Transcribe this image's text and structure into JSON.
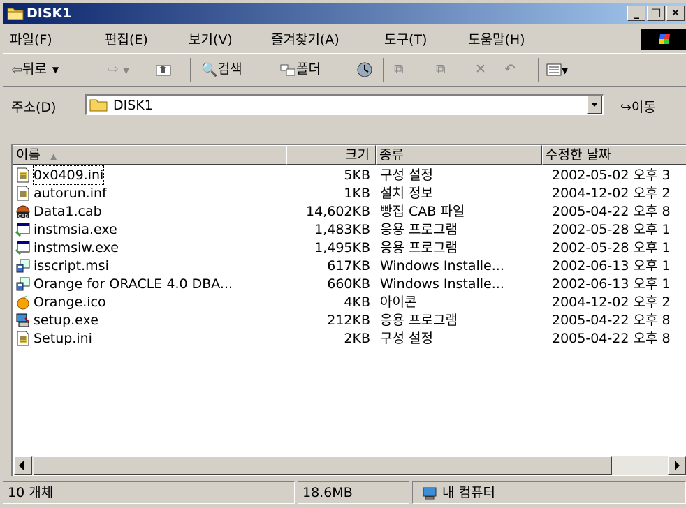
{
  "window": {
    "title": "DISK1"
  },
  "menu": [
    "파일(F)",
    "편집(E)",
    "보기(V)",
    "즐겨찾기(A)",
    "도구(T)",
    "도움말(H)"
  ],
  "toolbar": {
    "back": "뒤로",
    "search": "검색",
    "folders": "폴더"
  },
  "address": {
    "label": "주소(D)",
    "value": "DISK1",
    "go": "이동"
  },
  "columns": {
    "name": "이름",
    "size": "크기",
    "type": "종류",
    "modified": "수정한 날짜"
  },
  "files": [
    {
      "icon": "ini-file-icon",
      "name": "0x0409.ini",
      "size": "5KB",
      "type": "구성 설정",
      "modified": "2002-05-02 오후 3"
    },
    {
      "icon": "ini-file-icon",
      "name": "autorun.inf",
      "size": "1KB",
      "type": "설치 정보",
      "modified": "2004-12-02 오후 2"
    },
    {
      "icon": "cab-file-icon",
      "name": "Data1.cab",
      "size": "14,602KB",
      "type": "빵집 CAB 파일",
      "modified": "2005-04-22 오후 8"
    },
    {
      "icon": "exe-window-icon",
      "name": "instmsia.exe",
      "size": "1,483KB",
      "type": "응용 프로그램",
      "modified": "2002-05-28 오후 1"
    },
    {
      "icon": "exe-window-icon",
      "name": "instmsiw.exe",
      "size": "1,495KB",
      "type": "응용 프로그램",
      "modified": "2002-05-28 오후 1"
    },
    {
      "icon": "msi-installer-icon",
      "name": "isscript.msi",
      "size": "617KB",
      "type": "Windows Installe...",
      "modified": "2002-06-13 오후 1"
    },
    {
      "icon": "msi-installer-icon",
      "name": "Orange for ORACLE 4.0 DBA...",
      "size": "660KB",
      "type": "Windows Installe...",
      "modified": "2002-06-13 오후 1"
    },
    {
      "icon": "orange-icon",
      "name": "Orange.ico",
      "size": "4KB",
      "type": "아이콘",
      "modified": "2004-12-02 오후 2"
    },
    {
      "icon": "setup-exe-icon",
      "name": "setup.exe",
      "size": "212KB",
      "type": "응용 프로그램",
      "modified": "2005-04-22 오후 8"
    },
    {
      "icon": "ini-file-icon",
      "name": "Setup.ini",
      "size": "2KB",
      "type": "구성 설정",
      "modified": "2005-04-22 오후 8"
    }
  ],
  "status": {
    "count": "10 개체",
    "size": "18.6MB",
    "zone": "내 컴퓨터"
  }
}
